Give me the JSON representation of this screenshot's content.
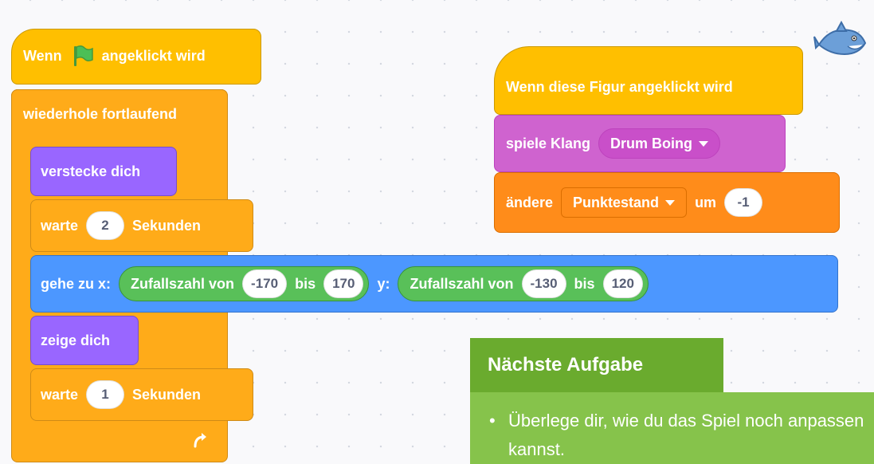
{
  "script1": {
    "hat_when": "Wenn",
    "hat_clicked": "angeklickt wird",
    "forever": "wiederhole fortlaufend",
    "hide": "verstecke dich",
    "wait_label": "warte",
    "wait1_value": "2",
    "seconds_label": "Sekunden",
    "goto_label": "gehe zu x:",
    "random_label": "Zufallszahl von",
    "random_to": "bis",
    "x_min": "-170",
    "x_max": "170",
    "y_label": "y:",
    "y_min": "-130",
    "y_max": "120",
    "show": "zeige dich",
    "wait2_value": "1"
  },
  "script2": {
    "hat": "Wenn diese Figur angeklickt wird",
    "play_sound": "spiele Klang",
    "sound_name": "Drum Boing",
    "change_label": "ändere",
    "variable": "Punktestand",
    "by_label": "um",
    "change_value": "-1"
  },
  "task": {
    "heading": "Nächste Aufgabe",
    "bullet": "•",
    "text": "Überlege dir, wie du das Spiel noch anpassen kannst."
  },
  "icons": [
    "green-flag-icon",
    "loop-arrow-icon",
    "shark-sprite-icon",
    "dropdown-caret-icon"
  ],
  "colors": {
    "events": "#ffbf00",
    "control": "#ffab19",
    "looks": "#9966ff",
    "motion": "#4c97ff",
    "operators": "#59c059",
    "sound": "#cf63cf",
    "variables": "#ff8c1a",
    "task_header": "#6aab2e",
    "task_body": "#86c34b"
  }
}
